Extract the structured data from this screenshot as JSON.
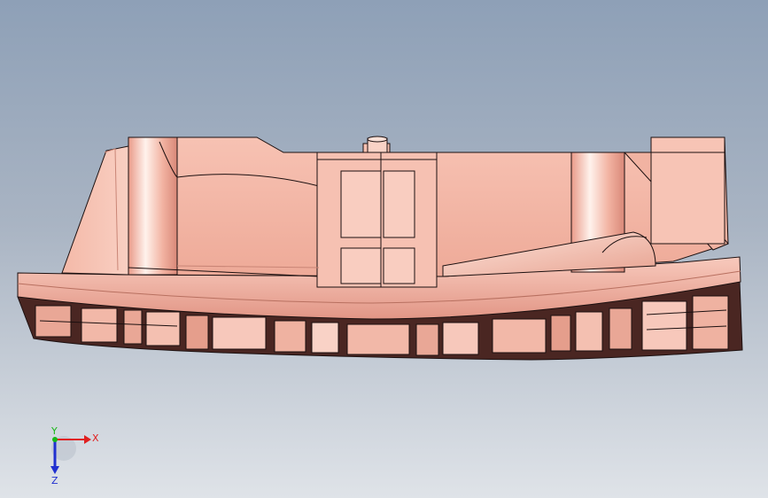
{
  "viewport": {
    "background_top": "#8ea0b7",
    "background_bottom": "#dfe3e8"
  },
  "model": {
    "base_color": "#f2b8a8",
    "shadow_color": "#c98576",
    "dark_color": "#4a2622",
    "edge_color": "#1c1010",
    "highlight_color": "#fff4f0"
  },
  "triad": {
    "x_label": "X",
    "y_label": "Y",
    "z_label": "Z",
    "x_color": "#e02020",
    "y_color": "#18b818",
    "z_color": "#2030d0"
  }
}
